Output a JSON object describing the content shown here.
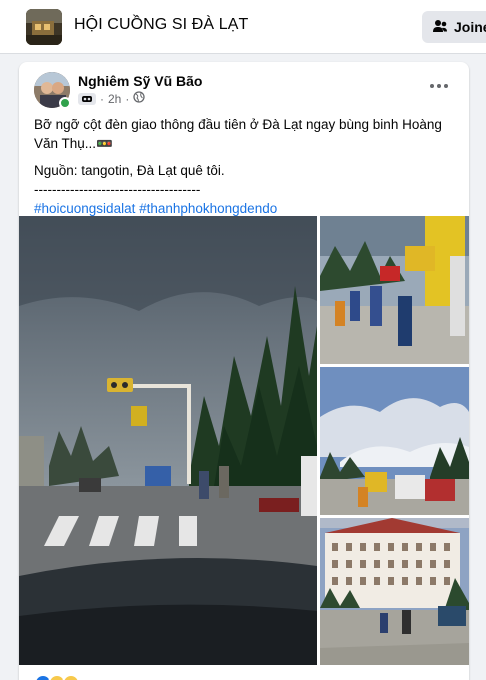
{
  "group": {
    "name": "HỘI CUỒNG SI ĐÀ LẠT",
    "join_label": "Joined",
    "thumbnail_icon": "group-photo"
  },
  "post": {
    "author": "Nghiêm Sỹ Vũ Bão",
    "time": "2h",
    "privacy_icon": "globe-icon",
    "more_icon": "more-dots-icon",
    "body": "Bỡ ngỡ cột đèn giao thông đầu tiên ở Đà Lạt ngay bùng binh Hoàng Văn Thụ...🚥",
    "source": "Nguồn: tangotin, Đà Lạt quê tôi.",
    "divider": "-------------------------------------",
    "hashtags": "#hoicuongsidalat #thanhphokhongdendo"
  },
  "colors": {
    "accent": "#1b74e4",
    "online": "#31a24c",
    "background": "#f0f2f5"
  }
}
